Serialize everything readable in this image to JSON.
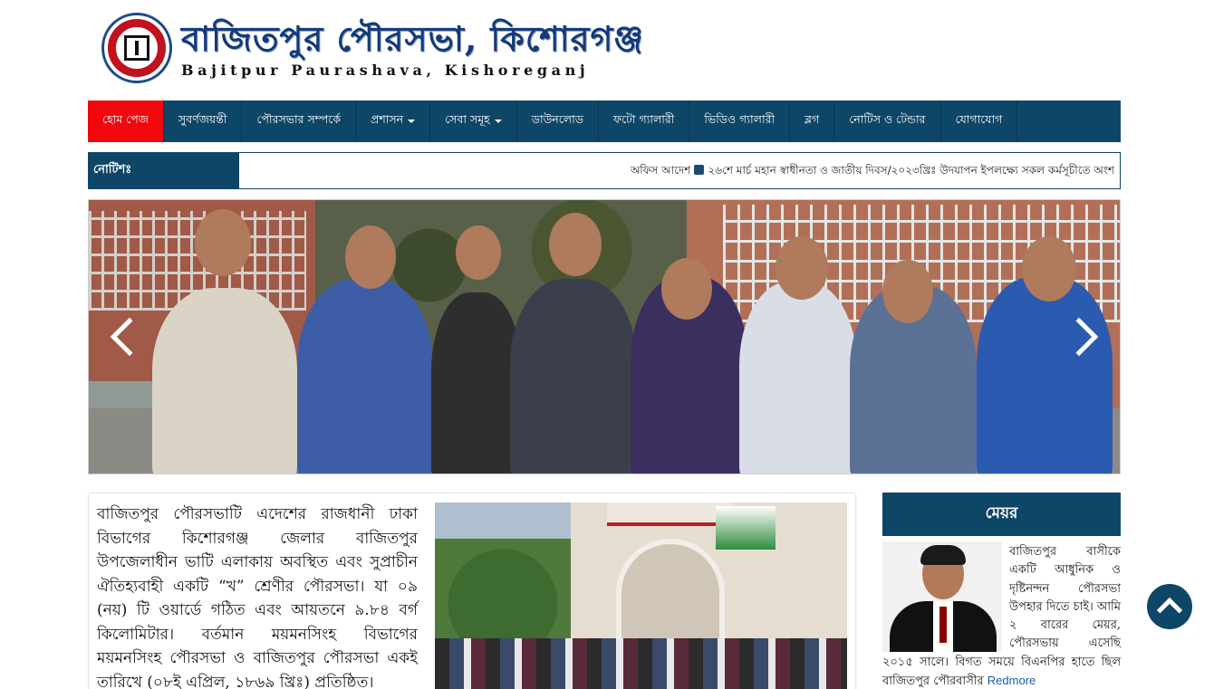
{
  "header": {
    "title_bn": "বাজিতপুর পৌরসভা, কিশোরগঞ্জ",
    "title_en": "Bajitpur Paurashava, Kishoreganj"
  },
  "nav": {
    "items": [
      {
        "label": "হোম পেজ",
        "active": true
      },
      {
        "label": "সুবর্ণজয়ন্তী"
      },
      {
        "label": "পৌরসভার সম্পর্কে"
      },
      {
        "label": "প্রশাসন",
        "dropdown": true
      },
      {
        "label": "সেবা সমূহ",
        "dropdown": true
      },
      {
        "label": "ডাউনলোড"
      },
      {
        "label": "ফটো গ্যালারী"
      },
      {
        "label": "ভিডিও গ্যালারী"
      },
      {
        "label": "ব্লগ"
      },
      {
        "label": "নোটিস ও টেন্ডার"
      },
      {
        "label": "যোগাযোগ"
      }
    ]
  },
  "notice": {
    "label": "নোটিশঃ",
    "item1": "অফিস আদেশ",
    "item2": "২৬শে মার্চ মহান স্বাধীনতা ও জাতীয় দিবস/২০২৩খ্রিঃ উদযাপন ইপলক্ষ্যে সকল কর্মসূচীতে অংশ"
  },
  "about": {
    "text": "বাজিতপুর পৌরসভাটি এদেশের রাজধানী ঢাকা বিভাগের কিশোরগঞ্জ জেলার বাজিতপুর উপজেলাধীন ভাটি এলাকায় অবস্থিত এবং সুপ্রাচীন ঐতিহ্যবাহী একটি “খ” শ্রেণীর পৌরসভা। যা ০৯ (নয়) টি ওয়ার্ডে গঠিত এবং আয়তনে ৯.৮৪ বর্গ কিলোমিটার। বর্তমান ময়মনসিংহ বিভাগের ময়মনসিংহ পৌরসভা ও বাজিতপুর পৌরসভা একই তারিখে (০৮ই এপ্রিল, ১৮৬৯ খ্রিঃ) প্রতিষ্ঠিত।"
  },
  "mayor": {
    "title": "মেয়র",
    "text": "বাজিতপুর বাসীকে একটি আধুনিক ও দৃষ্টিনন্দন পৌরসভা উপহার দিতে চাই। আমি ২ বারের মেয়র, পৌরসভায় এসেছি ২০১৫ সালে। বিগত সময়ে বিএনপির হাতে ছিল বাজিতপুর পৌরবাসীর",
    "more": "Redmore"
  },
  "colors": {
    "nav_bg": "#0e4668",
    "nav_active": "#f0080c",
    "link": "#1b5ba8"
  },
  "icons": {
    "slider_prev": "chevron-left-icon",
    "slider_next": "chevron-right-icon",
    "back_to_top": "chevron-up-icon"
  }
}
